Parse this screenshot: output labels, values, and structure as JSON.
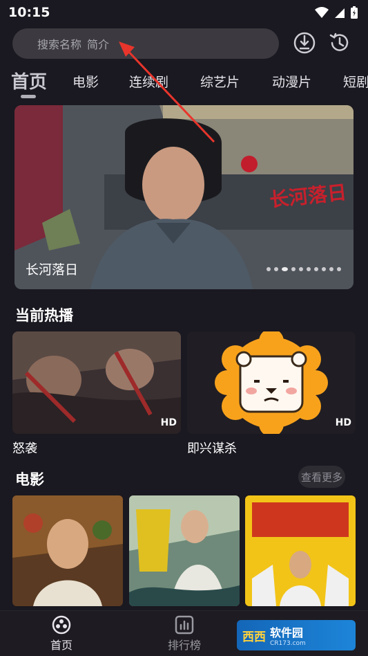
{
  "status": {
    "time": "10:15"
  },
  "search": {
    "placeholder_main": "搜索名称",
    "placeholder_sub": "简介"
  },
  "categories": [
    "首页",
    "电影",
    "连续剧",
    "综艺片",
    "动漫片",
    "短剧"
  ],
  "banner": {
    "title": "长河落日",
    "logo_text": "长河落日",
    "dots_total": 10,
    "dots_active": 1
  },
  "hot": {
    "title": "当前热播",
    "items": [
      {
        "name": "怒袭",
        "badge": "HD"
      },
      {
        "name": "即兴谋杀",
        "badge": "HD"
      }
    ]
  },
  "movies": {
    "title": "电影",
    "more_label": "查看更多"
  },
  "bottom_nav": {
    "home": "首页",
    "ranking": "排行榜"
  },
  "watermark": {
    "badge": "西西",
    "main": "软件园",
    "sub": "CR173.com"
  }
}
